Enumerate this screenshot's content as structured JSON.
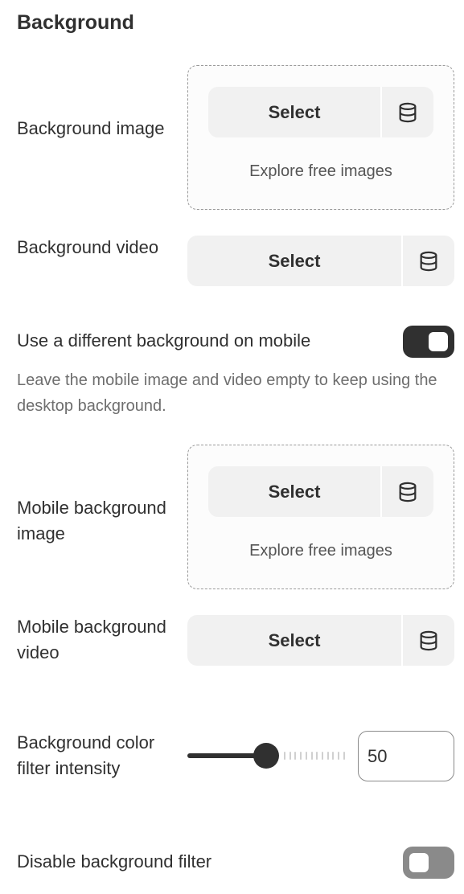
{
  "section": {
    "title": "Background"
  },
  "background_image": {
    "label": "Background image",
    "select_label": "Select",
    "icon": "database-icon",
    "explore_label": "Explore free images"
  },
  "background_video": {
    "label": "Background video",
    "select_label": "Select",
    "icon": "database-icon"
  },
  "mobile_toggle": {
    "label": "Use a different background on mobile",
    "enabled": true,
    "help": "Leave the mobile image and video empty to keep using the desktop background."
  },
  "mobile_image": {
    "label": "Mobile background image",
    "select_label": "Select",
    "icon": "database-icon",
    "explore_label": "Explore free images"
  },
  "mobile_video": {
    "label": "Mobile background video",
    "select_label": "Select",
    "icon": "database-icon"
  },
  "filter_intensity": {
    "label": "Background color filter intensity",
    "value": "50",
    "min": 0,
    "max": 100
  },
  "disable_filter": {
    "label": "Disable background filter",
    "enabled": false
  },
  "colors": {
    "text": "#303030",
    "button_bg": "#f1f1f1",
    "toggle_on": "#303030",
    "toggle_off": "#8a8a8a",
    "help_text": "#6e6e6e"
  }
}
